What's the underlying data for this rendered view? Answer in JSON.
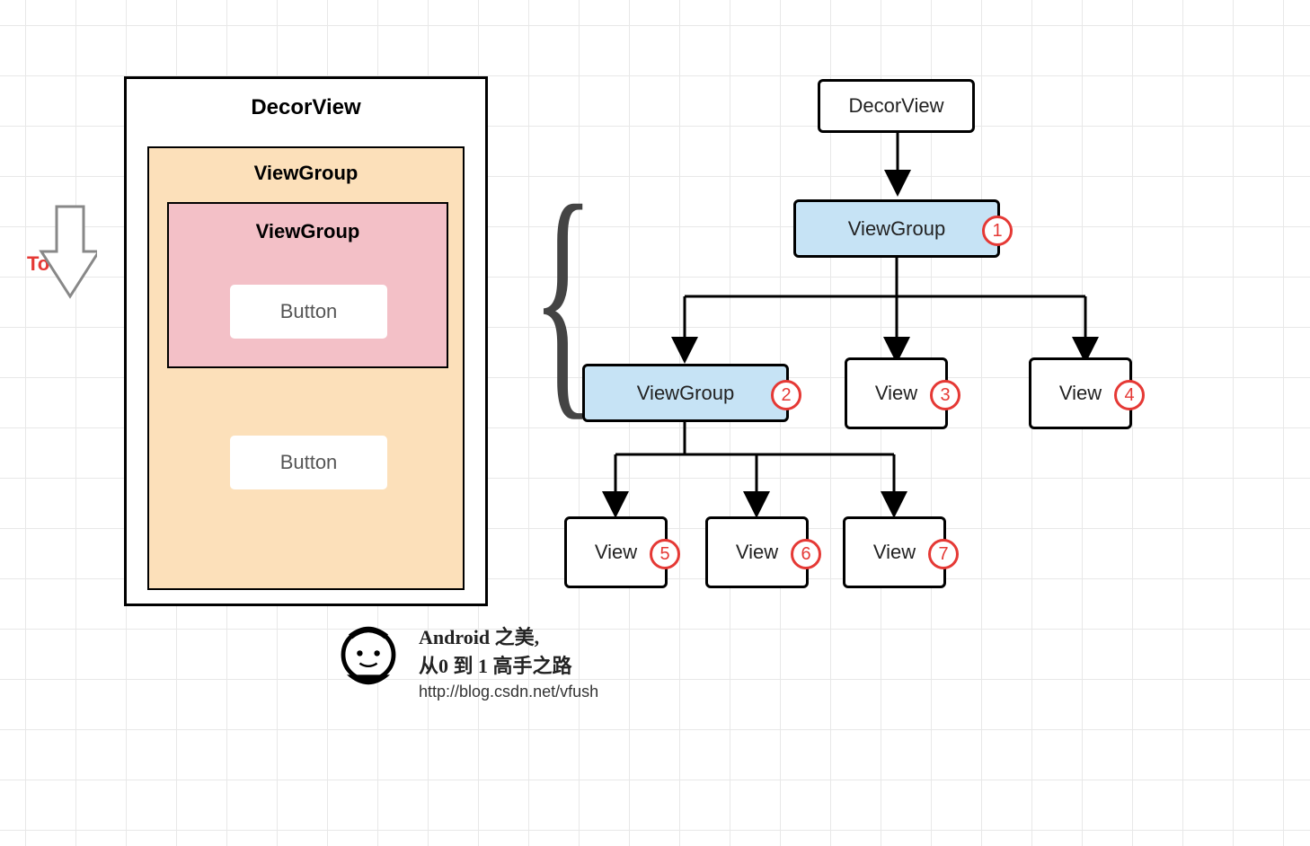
{
  "left_panel": {
    "decor_label": "DecorView",
    "viewgroup_outer_label": "ViewGroup",
    "viewgroup_inner_label": "ViewGroup",
    "button1_label": "Button",
    "button2_label": "Button"
  },
  "touch_label": "Touch",
  "tree": {
    "root_label": "DecorView",
    "vg1_label": "ViewGroup",
    "vg1_badge": "1",
    "vg2_label": "ViewGroup",
    "vg2_badge": "2",
    "view3_label": "View",
    "view3_badge": "3",
    "view4_label": "View",
    "view4_badge": "4",
    "view5_label": "View",
    "view5_badge": "5",
    "view6_label": "View",
    "view6_badge": "6",
    "view7_label": "View",
    "view7_badge": "7"
  },
  "footer": {
    "title_line1": "Android 之美,",
    "title_line2": "从0 到 1 高手之路",
    "url": "http://blog.csdn.net/vfush"
  }
}
